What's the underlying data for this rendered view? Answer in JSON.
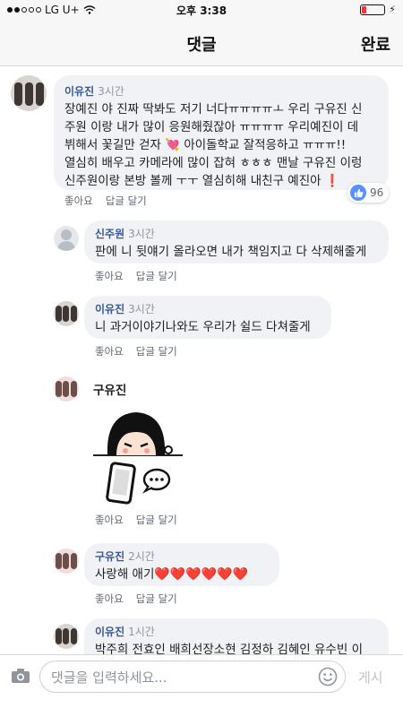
{
  "status_bar": {
    "carrier": "LG U+",
    "time": "오후 3:38"
  },
  "header": {
    "title": "댓글",
    "done_label": "완료"
  },
  "comments": [
    {
      "author": "이유진",
      "time": "3시간",
      "lines": [
        "장예진 야 진짜 딱봐도 저기 너다ㅠㅠㅠㅠㅗ 우리 구유진 신",
        "주원 이랑 내가 많이 응원해줬잖아 ㅠㅠㅠㅠ 우리예진이 데",
        "뷔해서 꽃길만 걷자 💘 아이돌학교 잘적응하고  ㅠㅠㅠ!!",
        "열심히 배우고 카메라에 많이 잡혀 ㅎㅎㅎ 맨날 구유진 이렁",
        "신주원이랑 본방 볼께 ㅜㅜ 열심히해 내친구 예진아 ❗"
      ],
      "reaction_count": "96",
      "like_label": "좋아요",
      "reply_label": "답글 달기"
    },
    {
      "author": "신주원",
      "time": "3시간",
      "text": "판에 니 뒷얘기 올라오면 내가 책임지고 다 삭제해줄게",
      "like_label": "좋아요",
      "reply_label": "답글 달기"
    },
    {
      "author": "이유진",
      "time": "3시간",
      "text": "니 과거이야기나와도 우리가 쉴드 다쳐줄게",
      "like_label": "좋아요",
      "reply_label": "답글 달기"
    },
    {
      "author": "구유진",
      "like_label": "좋아요",
      "reply_label": "답글 달기"
    },
    {
      "author": "구유진",
      "time": "2시간",
      "text": "사랑해 애기",
      "hearts": "❤️❤️❤️❤️❤️❤️",
      "like_label": "좋아요",
      "reply_label": "답글 달기"
    },
    {
      "author": "이유진",
      "time": "1시간",
      "text": "박주희 전효인 배희선장소현 김정하 김혜인 유수빈 이"
    }
  ],
  "composer": {
    "placeholder": "댓글을 입력하세요...",
    "post_label": "게시"
  },
  "colors": {
    "name_blue": "#385898",
    "bubble_bg": "#f1f2f6",
    "like_blue": "#5890ff",
    "heart_red": "#e0245e"
  }
}
